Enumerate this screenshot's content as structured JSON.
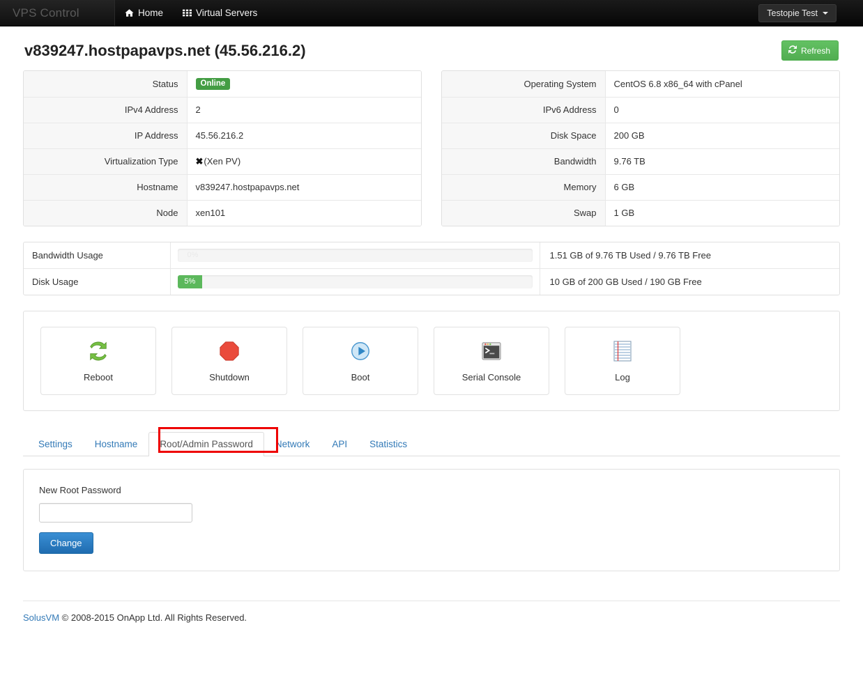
{
  "navbar": {
    "brand": "VPS Control",
    "links": [
      {
        "label": "Home",
        "icon": "home-icon"
      },
      {
        "label": "Virtual Servers",
        "icon": "grid-icon"
      }
    ],
    "user_menu": "Testopie Test"
  },
  "header": {
    "title": "v839247.hostpapavps.net (45.56.216.2)",
    "refresh_label": "Refresh",
    "refresh_icon": "refresh-icon",
    "refresh_color": "#5cb85c"
  },
  "info_left": [
    {
      "key": "Status",
      "value": "Online",
      "type": "badge",
      "badge_color": "#449d44"
    },
    {
      "key": "IPv4 Address",
      "value": "2"
    },
    {
      "key": "IP Address",
      "value": "45.56.216.2"
    },
    {
      "key": "Virtualization Type",
      "value": "(Xen PV)",
      "icon": "xen-icon"
    },
    {
      "key": "Hostname",
      "value": "v839247.hostpapavps.net"
    },
    {
      "key": "Node",
      "value": "xen101"
    }
  ],
  "info_right": [
    {
      "key": "Operating System",
      "value": "CentOS 6.8 x86_64 with cPanel"
    },
    {
      "key": "IPv6 Address",
      "value": "0"
    },
    {
      "key": "Disk Space",
      "value": "200 GB"
    },
    {
      "key": "Bandwidth",
      "value": "9.76 TB"
    },
    {
      "key": "Memory",
      "value": "6 GB"
    },
    {
      "key": "Swap",
      "value": "1 GB"
    }
  ],
  "usage": [
    {
      "label": "Bandwidth Usage",
      "percent_label": "0%",
      "percent": 0,
      "text": "1.51 GB of 9.76 TB Used / 9.76 TB Free"
    },
    {
      "label": "Disk Usage",
      "percent_label": "5%",
      "percent": 5,
      "text": "10 GB of 200 GB Used / 190 GB Free"
    }
  ],
  "actions": [
    {
      "label": "Reboot",
      "icon": "reboot-icon"
    },
    {
      "label": "Shutdown",
      "icon": "shutdown-icon"
    },
    {
      "label": "Boot",
      "icon": "boot-icon"
    },
    {
      "label": "Serial Console",
      "icon": "terminal-icon"
    },
    {
      "label": "Log",
      "icon": "log-icon"
    }
  ],
  "tabs": [
    {
      "label": "Settings",
      "active": false
    },
    {
      "label": "Hostname",
      "active": false
    },
    {
      "label": "Root/Admin Password",
      "active": true
    },
    {
      "label": "Network",
      "active": false
    },
    {
      "label": "API",
      "active": false
    },
    {
      "label": "Statistics",
      "active": false
    }
  ],
  "form": {
    "label": "New Root Password",
    "value": "",
    "placeholder": "",
    "submit_label": "Change"
  },
  "footer": {
    "link": "SolusVM",
    "text": " © 2008-2015 OnApp Ltd. All Rights Reserved."
  }
}
